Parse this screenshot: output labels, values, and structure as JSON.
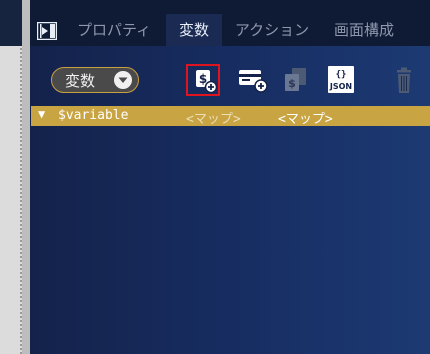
{
  "tabs": [
    {
      "label": "プロパティ",
      "active": false
    },
    {
      "label": "変数",
      "active": true
    },
    {
      "label": "アクション",
      "active": false
    },
    {
      "label": "画面構成",
      "active": false
    }
  ],
  "toolbar": {
    "variable_select_label": "変数",
    "tools": [
      {
        "icon": "add-variable-icon",
        "highlighted": true
      },
      {
        "icon": "add-card-icon",
        "highlighted": false
      },
      {
        "icon": "copy-variable-icon",
        "highlighted": false
      },
      {
        "icon": "json-icon",
        "highlighted": false
      },
      {
        "icon": "trash-icon",
        "highlighted": false
      }
    ],
    "json_text": "JSON",
    "json_braces": "{}"
  },
  "variable_row": {
    "expand_glyph": "▼",
    "name": "$variable",
    "type": "<マップ>",
    "value": "<マップ>"
  },
  "colors": {
    "accent_gold": "#c9a443",
    "highlight_red": "#e0141e",
    "panel_bg": "#172e63"
  }
}
